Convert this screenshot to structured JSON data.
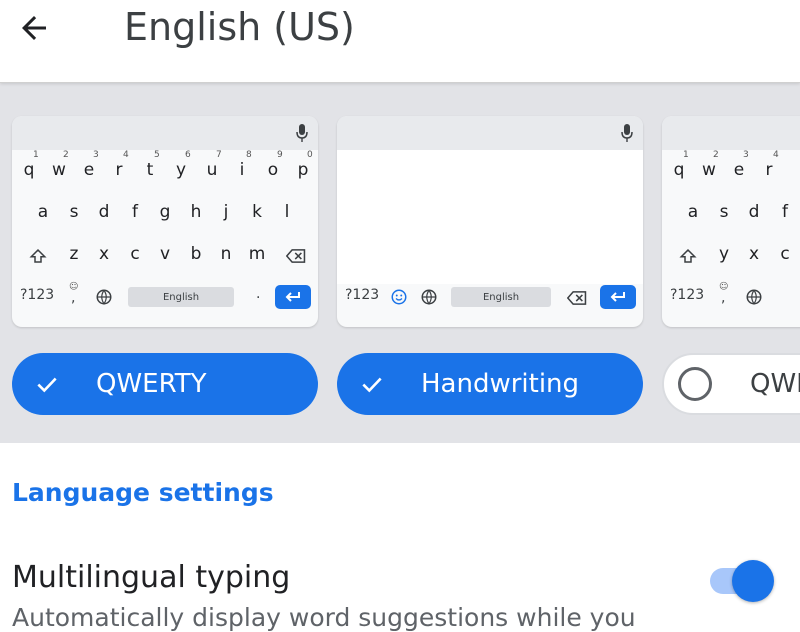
{
  "header": {
    "title": "English (US)",
    "back_icon": "arrow-left-icon"
  },
  "layouts": {
    "qwerty_card": {
      "row1_keys": [
        "q",
        "w",
        "e",
        "r",
        "t",
        "y",
        "u",
        "i",
        "o",
        "p"
      ],
      "row1_hints": [
        "1",
        "2",
        "3",
        "4",
        "5",
        "6",
        "7",
        "8",
        "9",
        "0"
      ],
      "row2_keys": [
        "a",
        "s",
        "d",
        "f",
        "g",
        "h",
        "j",
        "k",
        "l"
      ],
      "row3_keys": [
        "z",
        "x",
        "c",
        "v",
        "b",
        "n",
        "m"
      ],
      "symbols_key": "?123",
      "comma_key": ",",
      "period_key": ".",
      "spacebar_label": "English"
    },
    "handwriting_card": {
      "symbols_key": "?123",
      "spacebar_label": "English"
    },
    "partial_card": {
      "row1_keys": [
        "q",
        "w",
        "e",
        "r"
      ],
      "row1_hints": [
        "1",
        "2",
        "3",
        "4"
      ],
      "row2_keys": [
        "a",
        "s",
        "d",
        "f"
      ],
      "row3_keys": [
        "y",
        "x",
        "c"
      ],
      "symbols_key": "?123",
      "comma_key": ","
    },
    "chips": [
      {
        "label": "QWERTY",
        "selected": true
      },
      {
        "label": "Handwriting",
        "selected": true
      },
      {
        "label": "QWI",
        "selected": false
      }
    ]
  },
  "settings": {
    "section_title": "Language settings",
    "multilingual": {
      "title": "Multilingual typing",
      "subtitle": "Automatically display word suggestions while you",
      "enabled": true
    }
  },
  "colors": {
    "accent": "#1a73e8",
    "strip_bg": "#e2e3e7"
  }
}
